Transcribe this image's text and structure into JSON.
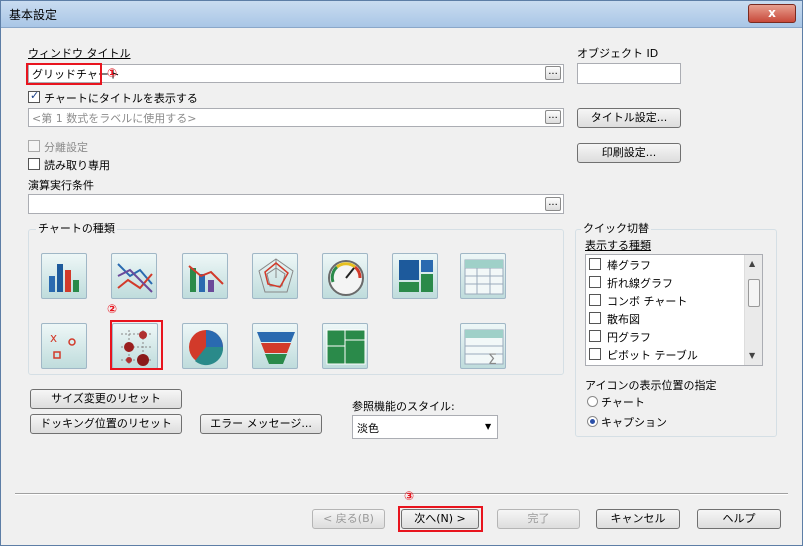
{
  "window": {
    "title": "基本設定",
    "close": "x"
  },
  "window_title": {
    "label": "ウィンドウ タイトル",
    "value": "グリッドチャート",
    "annotation": "①",
    "browse": "..."
  },
  "object_id": {
    "label": "オブジェクト ID",
    "value": ""
  },
  "show_title": {
    "label": "チャートにタイトルを表示する",
    "checked": true,
    "placeholder": "<第 1 数式をラベルに使用する>",
    "browse": "..."
  },
  "title_settings_button": "タイトル設定...",
  "print_settings_button": "印刷設定...",
  "detach": {
    "label": "分離設定",
    "checked": false,
    "enabled": false
  },
  "read_only": {
    "label": "読み取り専用",
    "checked": false
  },
  "calc_condition": {
    "label": "演算実行条件",
    "value": "",
    "browse": "..."
  },
  "chart_types": {
    "label": "チャートの種類",
    "selected_annotation": "②",
    "items": [
      {
        "icon": "bar-chart-icon"
      },
      {
        "icon": "line-chart-icon"
      },
      {
        "icon": "combo-chart-icon"
      },
      {
        "icon": "radar-chart-icon"
      },
      {
        "icon": "gauge-chart-icon"
      },
      {
        "icon": "block-chart-icon"
      },
      {
        "icon": "pivot-table-icon"
      },
      {
        "icon": "scatter-chart-icon"
      },
      {
        "icon": "grid-chart-icon",
        "selected": true
      },
      {
        "icon": "pie-chart-icon"
      },
      {
        "icon": "funnel-chart-icon"
      },
      {
        "icon": "mekko-chart-icon"
      },
      {
        "icon": "straight-table-icon"
      }
    ]
  },
  "quick_change": {
    "label": "クイック切替",
    "types_label": "表示する種類",
    "types": [
      "棒グラフ",
      "折れ線グラフ",
      "コンボ チャート",
      "散布図",
      "円グラフ",
      "ピボット テーブル"
    ],
    "icon_position_label": "アイコンの表示位置の指定",
    "icon_position_options": [
      {
        "label": "チャート",
        "selected": false
      },
      {
        "label": "キャプション",
        "selected": true
      }
    ]
  },
  "reset_size_button": "サイズ変更のリセット",
  "reset_docking_button": "ドッキング位置のリセット",
  "error_messages_button": "エラー メッセージ...",
  "reference_style": {
    "label": "参照機能のスタイル:",
    "value": "淡色"
  },
  "footer": {
    "back": "< 戻る(B)",
    "next": "次へ(N) >",
    "next_annotation": "③",
    "finish": "完了",
    "cancel": "キャンセル",
    "help": "ヘルプ"
  },
  "colors": {
    "annotation_red": "#e8141e",
    "title_bar": "#b9d1ea"
  }
}
